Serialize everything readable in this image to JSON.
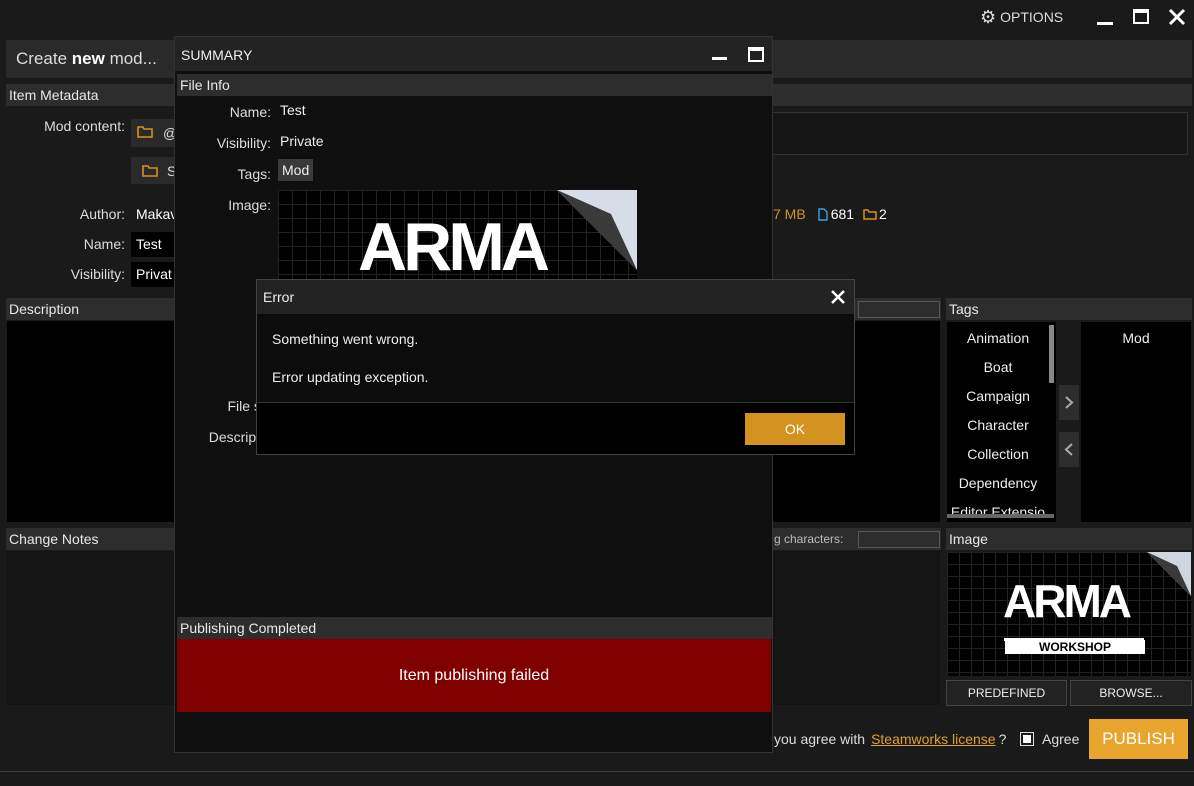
{
  "topbar": {
    "options_label": "OPTIONS"
  },
  "main": {
    "title_prefix": "Create",
    "title_bold": "new",
    "title_suffix": "mod...",
    "metadata_header": "Item Metadata",
    "mod_content_label": "Mod content:",
    "mod_content_row1": "@",
    "mod_content_row2": "S",
    "author_label": "Author:",
    "author_value": "Makav",
    "name_label": "Name:",
    "name_value": "Test",
    "visibility_label": "Visibility:",
    "visibility_value": "Privat",
    "size_fragment": "7 MB",
    "file_count": "681",
    "folder_count": "2",
    "description_header": "Description",
    "change_notes_header": "Change Notes",
    "remaining_chars_label": "g characters:",
    "tags_header": "Tags",
    "tags_available": [
      "Animation",
      "Boat",
      "Campaign",
      "Character",
      "Collection",
      "Dependency",
      "Editor Extensio"
    ],
    "tags_selected": [
      "Mod"
    ],
    "image_header": "Image",
    "predefined_button": "PREDEFINED",
    "browse_button": "BROWSE...",
    "license_prefix": "you agree with",
    "license_link": "Steamworks license",
    "license_suffix": "?",
    "agree_label": "Agree",
    "publish_button": "PUBLISH"
  },
  "summary": {
    "title": "SUMMARY",
    "file_info_header": "File Info",
    "name_label": "Name:",
    "name_value": "Test",
    "visibility_label": "Visibility:",
    "visibility_value": "Private",
    "tags_label": "Tags:",
    "tag_value": "Mod",
    "image_label": "Image:",
    "file_size_label": "File siz",
    "description_label": "Descriptio",
    "publishing_header": "Publishing Completed",
    "status_message": "Item publishing failed"
  },
  "error_dialog": {
    "title": "Error",
    "message1": "Something went wrong.",
    "message2": "Error updating exception.",
    "ok_button": "OK"
  },
  "logo": {
    "arma_text": "ARMA",
    "workshop_text": "WORKSHOP"
  },
  "colors": {
    "accent": "#d4921e",
    "failed": "#800000",
    "link": "#e0a030",
    "file_icon": "#3aa0e0"
  }
}
